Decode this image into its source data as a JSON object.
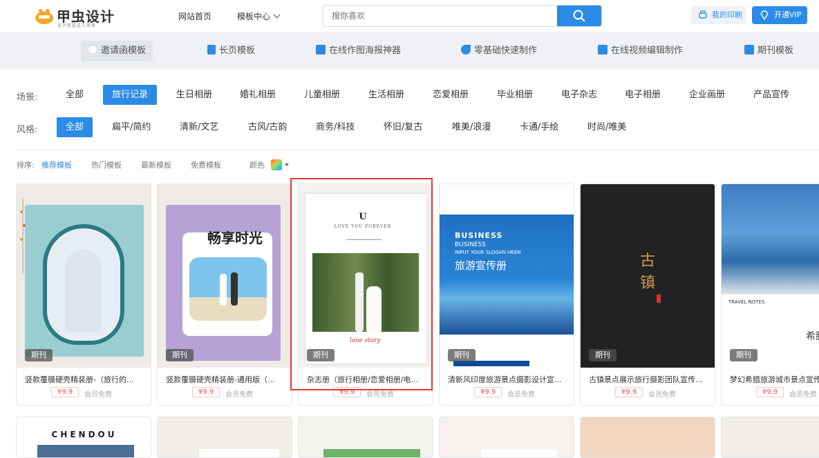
{
  "header": {
    "logo_text": "甲虫设计",
    "logo_slogan": "设计就是这么简单",
    "nav_home": "网站首页",
    "nav_templates": "模板中心",
    "search_placeholder": "搜你喜欢",
    "my_print": "我的印刷",
    "vip": "开通VIP"
  },
  "categories": [
    {
      "label": "邀请函模板",
      "icon": "invite-icon"
    },
    {
      "label": "长页模板",
      "icon": "longpage-icon"
    },
    {
      "label": "在线作图海报神器",
      "icon": "image-icon"
    },
    {
      "label": "零基础快速制作",
      "icon": "magic-icon"
    },
    {
      "label": "在线视频编辑制作",
      "icon": "video-icon"
    },
    {
      "label": "期刊模板",
      "icon": "journal-icon"
    }
  ],
  "scene": {
    "label": "场景:",
    "items": [
      "全部",
      "旅行记录",
      "生日相册",
      "婚礼相册",
      "儿童相册",
      "生活相册",
      "恋爱相册",
      "毕业相册",
      "电子杂志",
      "电子相册",
      "企业画册",
      "产品宣传"
    ],
    "active_index": 1
  },
  "style": {
    "label": "风格:",
    "items": [
      "全部",
      "扁平/简约",
      "清新/文艺",
      "古风/古韵",
      "商务/科技",
      "怀旧/复古",
      "唯美/浪漫",
      "卡通/手绘",
      "时尚/唯美"
    ],
    "active_index": 0
  },
  "sort": {
    "label": "排序:",
    "items": [
      "推荐模板",
      "热门模板",
      "最新模板",
      "免费模板"
    ],
    "active_index": 0,
    "color_label": "颜色"
  },
  "cards": [
    {
      "badge": "期刊",
      "title": "竖款覆膜硬壳精装册-（旅行的...",
      "price": "¥9.9",
      "free": "会员免费",
      "cover_text": ""
    },
    {
      "badge": "期刊",
      "title": "竖款覆膜硬壳精装册-通用版（...",
      "price": "¥9.9",
      "free": "会员免费",
      "cover_text": "畅享时光"
    },
    {
      "badge": "期刊",
      "title": "杂志册（旅行相册/恋爱相册/电...",
      "price": "¥9.9",
      "free": "会员免费",
      "cover_text": "U",
      "cover_sub": "LOVE YOU FOREVER",
      "cover_script": "love story"
    },
    {
      "badge": "期刊",
      "title": "清新风印度旅游景点摄影设计宣...",
      "price": "¥9.9",
      "free": "会员免费",
      "cover_text": "BUSINESS",
      "cover_sub": "BUSINESS",
      "cover_line": "INPUT YOUR SLOGAN HEEN",
      "cover_cn": "旅游宣传册"
    },
    {
      "badge": "期刊",
      "title": "古镇景点展示旅行摄影团队宣传...",
      "price": "¥9.9",
      "free": "会员免费",
      "cover_text": "古镇"
    },
    {
      "badge": "期刊",
      "title": "梦幻希腊旅游城市景点宣传",
      "price": "¥9.9",
      "free": "会员免费",
      "cover_text": "TRAVEL NOTES",
      "cover_cn": "希腊"
    }
  ],
  "row2": {
    "first_title": "CHENDOU"
  },
  "colors": {
    "accent": "#2b8be6",
    "price": "#f05050"
  }
}
